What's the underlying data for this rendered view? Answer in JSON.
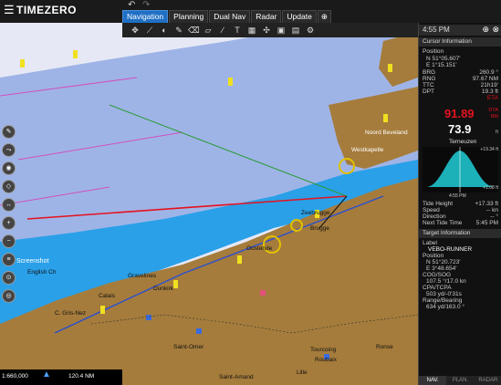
{
  "app": {
    "logo": "TIMEZERO",
    "menu_icon": "hamburger-icon"
  },
  "tabs": [
    {
      "label": "Navigation",
      "active": true
    },
    {
      "label": "Planning"
    },
    {
      "label": "Dual Nav"
    },
    {
      "label": "Radar"
    },
    {
      "label": "Update"
    },
    {
      "label": "⊕"
    }
  ],
  "colors": {
    "land": "#a57c3c",
    "shallow": "#2aa0e8",
    "deep": "#e6e9f5",
    "accent": "#1f6fc5",
    "route_red": "#e5121e"
  },
  "map": {
    "labels": {
      "noord_beveland": "Noord Beveland",
      "westkapelle": "Westkapelle",
      "dunkirk": "Dunkirk",
      "calais": "Calais",
      "lille": "Lille",
      "zeebrugge": "Zeebrugge",
      "brugge": "Brugge",
      "screenshot": "Screenshot",
      "english_channel": "English Ch",
      "ostend": "Oostende",
      "cap_gris_nez": "C. Gris-Nez",
      "gravelines": "Gravelines",
      "tourcoing": "Tourcoing",
      "roubaix": "Roubaix",
      "saint_omer": "Saint-Omer",
      "saint_amand": "Saint-Amand",
      "ronse": "Ronse"
    },
    "scale": "1:660,000",
    "distance": "120.4 NM"
  },
  "panel": {
    "time": "4:55 PM",
    "cursor_header": "Cursor Information",
    "position_label": "Position",
    "lat": "N 51°05.607'",
    "lon": "E 1°15.151'",
    "brg_label": "BRG",
    "brg": "260.9 °",
    "rng_label": "RNG",
    "rng": "97.67 NM",
    "ttc_label": "TTC",
    "ttc": "21h19'",
    "dpt_label": "DPT",
    "dpt": "19.3 ft",
    "eta_label": "ETA",
    "dta_value": "91.89",
    "dta_label": "DTA",
    "dta_unit": "NM",
    "dpt_big": "73.9",
    "dpt_unit": "ft",
    "tide_station": "Terneuzen",
    "tide_top": "+19.34 ft",
    "tide_now": "+1.08 ft",
    "tide_time": "4:55 PM",
    "tide_height_label": "Tide Height",
    "tide_height": "+17.33 ft",
    "speed_label": "Speed",
    "speed": "-- kn",
    "direction_label": "Direction",
    "direction": "-- °",
    "next_tide_label": "Next Tide Time",
    "next_tide": "5:45 PM",
    "target_header": "Target Information",
    "label_label": "Label",
    "target_name": "VEBO-RUNNER",
    "t_position_label": "Position",
    "t_lat": "N 51°20.723'",
    "t_lon": "E 3°48.654'",
    "cog_label": "COG/SOG",
    "cog": "107.5 °/17.0 kn",
    "cpa_label": "CPA/TCPA",
    "cpa": "503 yd/-0'31s",
    "range_label": "Range/Bearing",
    "range": "634 yd/163.0 °",
    "bottom_tabs": [
      "NAV.",
      "PLAN.",
      "RADAR"
    ]
  }
}
